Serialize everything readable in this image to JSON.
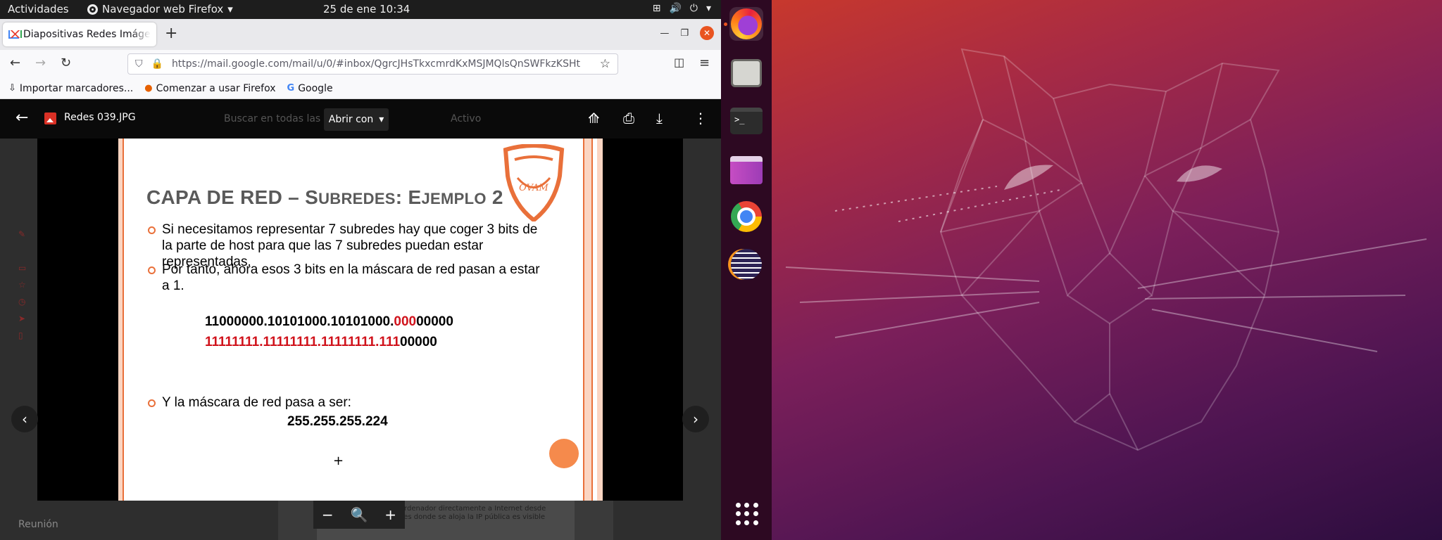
{
  "topbar": {
    "activities": "Actividades",
    "app_menu": "Navegador web Firefox",
    "clock": "25 de ene  10:34"
  },
  "browser": {
    "tab_title": "Diapositivas Redes Imágenes",
    "tab_close": "✕",
    "new_tab": "+",
    "url": "https://mail.google.com/mail/u/0/#inbox/QgrcJHsTkxcmrdKxMSJMQlsQnSWFkzKSHt",
    "bookmarks": [
      {
        "label": "Importar marcadores..."
      },
      {
        "label": "Comenzar a usar Firefox"
      },
      {
        "label": "Google"
      }
    ]
  },
  "viewer": {
    "file_name": "Redes 039.JPG",
    "open_with": "Abrir con",
    "ghost_search": "Buscar en todas las",
    "ghost_status": "Activo",
    "ghost_label_reunion": "Reunión",
    "ghost_card_text": "Para conectar un ordenador directamente a Internet desde casa o los servidores donde se aloja la IP pública es visible desde Internet",
    "slide": {
      "title_caps_1": "CAPA DE RED – S",
      "title_small_1": "UBREDES",
      "title_caps_2": ": E",
      "title_small_2": "JEMPLO",
      "title_caps_3": " 2",
      "bullet_1": "Si necesitamos representar 7 subredes hay que coger 3 bits de la parte de host para que las 7 subredes puedan estar representadas.",
      "bullet_2": "Por tanto, ahora esos 3 bits en la máscara de red pasan a estar a 1.",
      "line1_black": "11000000.10101000.10101000.",
      "line1_red": "000",
      "line1_tail": "00000",
      "line2_red": "11111111.11111111.11111111.111",
      "line2_tail": "00000",
      "bullet_3": "Y la máscara de red pasa a ser:",
      "mask": "255.255.255.224",
      "plus": "+"
    },
    "zoom_minus": "−",
    "zoom_plus": "+"
  },
  "dock": {
    "apps": [
      "firefox-icon",
      "files-icon",
      "terminal-icon",
      "software-store-icon",
      "chrome-icon",
      "eclipse-icon"
    ],
    "terminal_prompt": ">_"
  },
  "colors": {
    "accent_orange": "#e9703a",
    "red_bits": "#d0121b",
    "ubuntu_orange": "#e95420"
  }
}
